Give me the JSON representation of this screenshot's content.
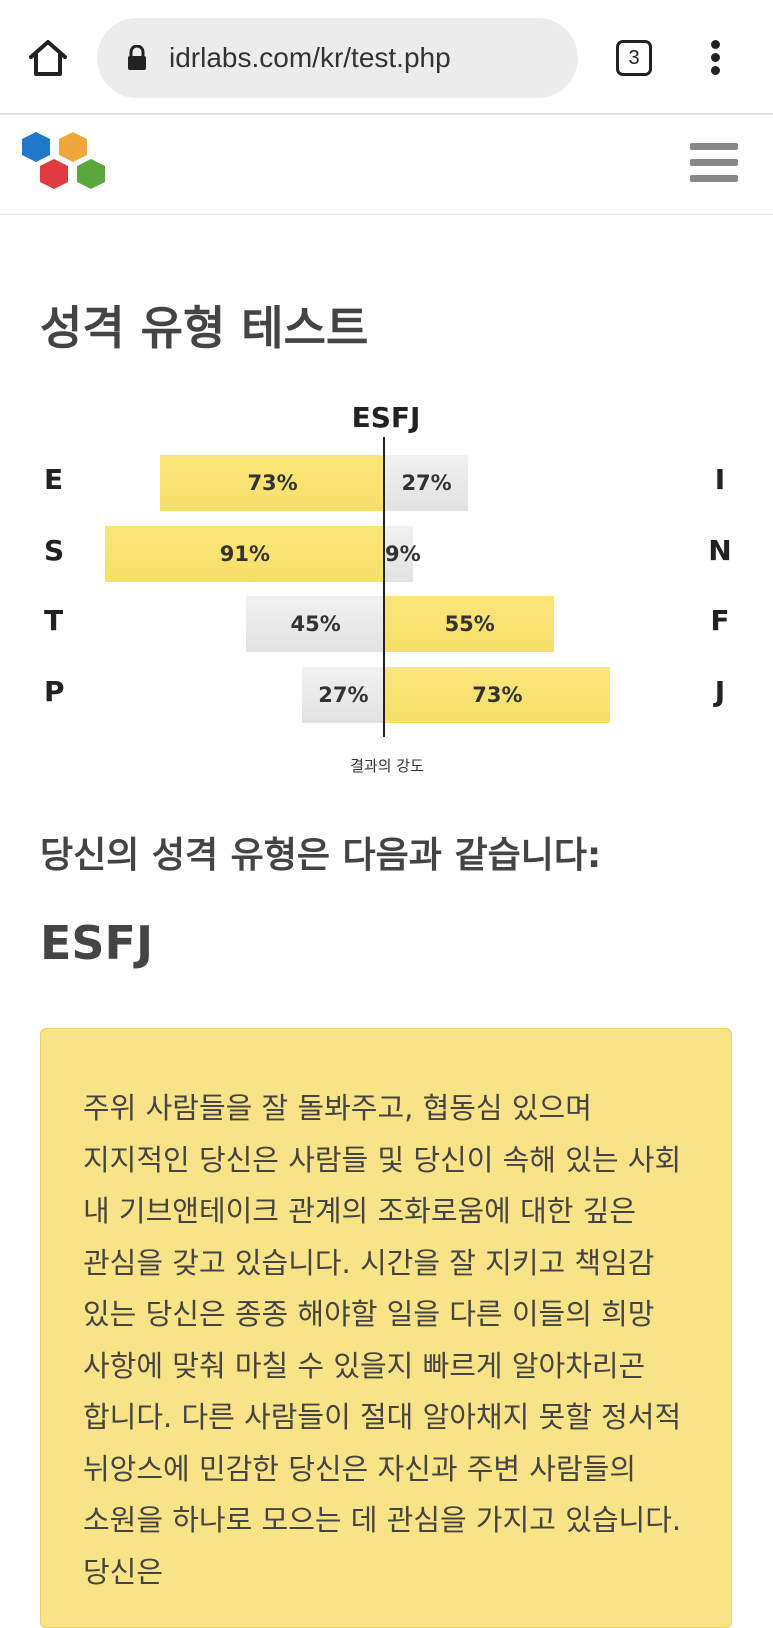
{
  "browser": {
    "url": "idrlabs.com/kr/test.php",
    "tab_count": "3",
    "icons": [
      "home-icon",
      "lock-icon",
      "tabs-icon",
      "more-vert-icon"
    ]
  },
  "site": {
    "logo": "idrlabs-hexagon-logo",
    "menu_icon": "hamburger-menu-icon",
    "logo_colors": [
      "#1f78c8",
      "#f0a73a",
      "#e03b3f",
      "#5aa83c"
    ]
  },
  "page": {
    "title": "성격 유형 테스트",
    "result_heading": "당신의 성격 유형은 다음과 같습니다:",
    "result_type": "ESFJ",
    "description": "주위 사람들을 잘 돌봐주고, 협동심 있으며 지지적인 당신은 사람들 및 당신이 속해 있는 사회 내 기브앤테이크 관계의 조화로움에 대한 깊은 관심을 갖고 있습니다. 시간을 잘 지키고 책임감 있는 당신은 종종 해야할 일을 다른 이들의 희망 사항에 맞춰 마칠 수 있을지 빠르게 알아차리곤 합니다. 다른 사람들이 절대 알아채지 못할 정서적 뉘앙스에 민감한 당신은 자신과 주변 사람들의 소원을 하나로 모으는 데 관심을 가지고 있습니다. 당신은"
  },
  "chart_data": {
    "type": "bar",
    "title": "ESFJ",
    "caption": "결과의 강도",
    "colors": {
      "winner": "#f8e27a",
      "loser": "#e8e8e8"
    },
    "rows": [
      {
        "left": "E",
        "right": "I",
        "left_pct": 73,
        "right_pct": 27,
        "left_label": "73%",
        "right_label": "27%",
        "winner": "left"
      },
      {
        "left": "S",
        "right": "N",
        "left_pct": 91,
        "right_pct": 9,
        "left_label": "91%",
        "right_label": "9%",
        "winner": "left"
      },
      {
        "left": "T",
        "right": "F",
        "left_pct": 45,
        "right_pct": 55,
        "left_label": "45%",
        "right_label": "55%",
        "winner": "right"
      },
      {
        "left": "P",
        "right": "J",
        "left_pct": 27,
        "right_pct": 73,
        "left_label": "27%",
        "right_label": "73%",
        "winner": "right"
      }
    ]
  }
}
